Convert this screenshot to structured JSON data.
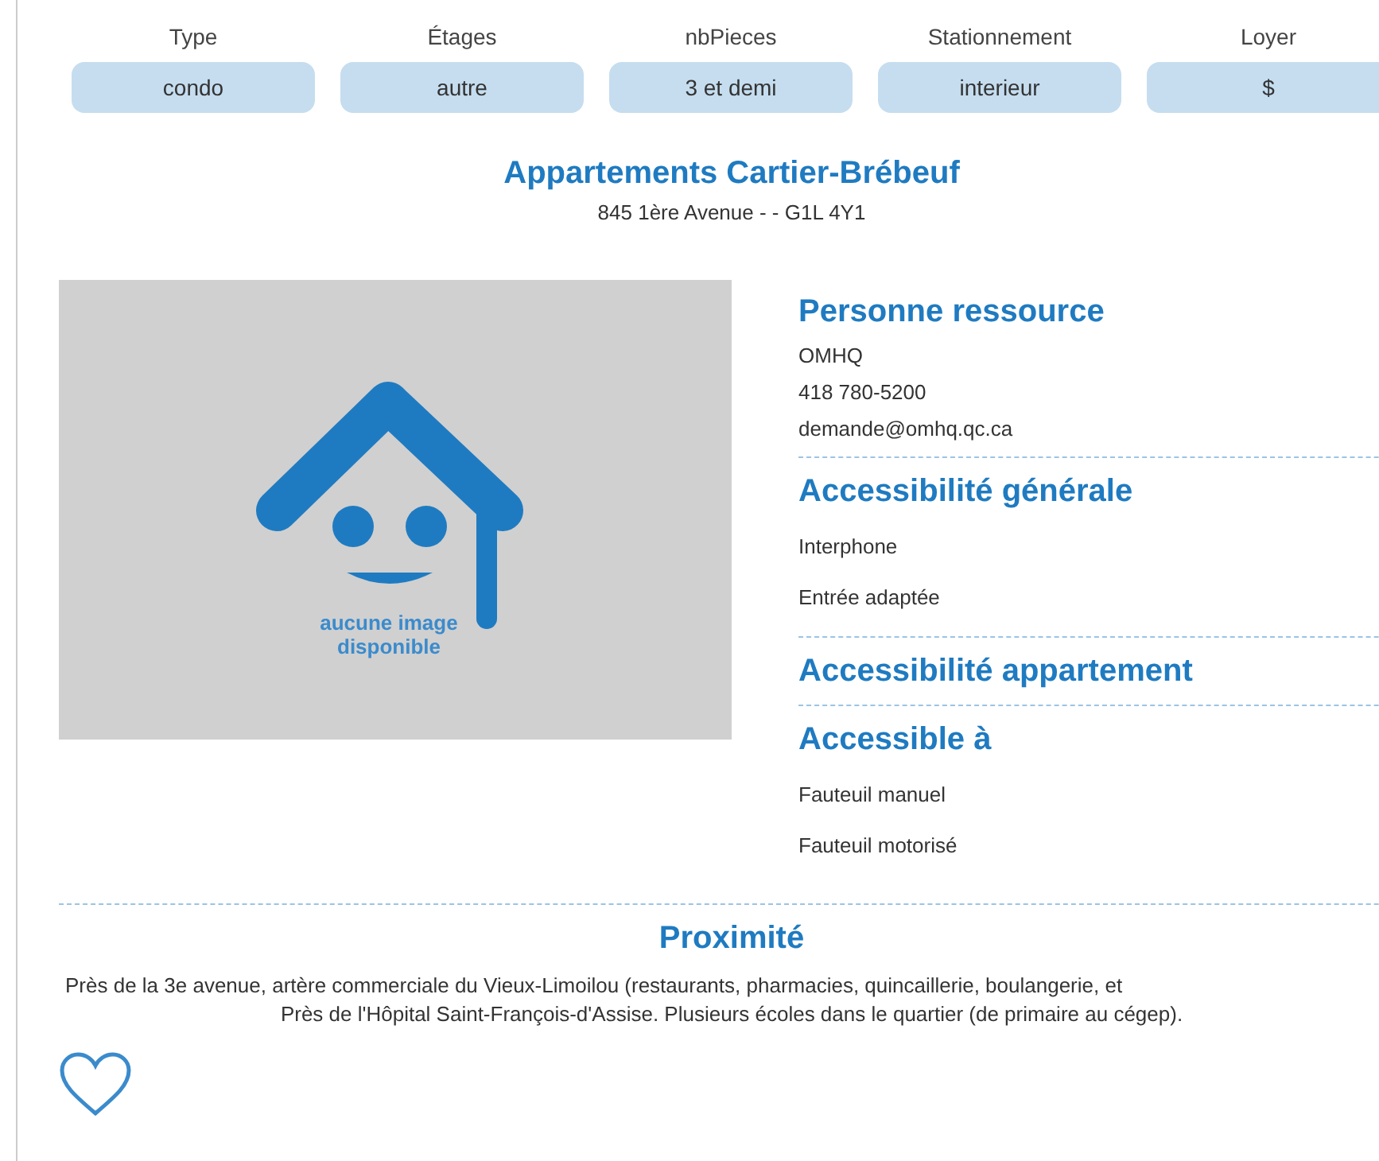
{
  "filters": [
    {
      "label": "Type",
      "value": "condo"
    },
    {
      "label": "Étages",
      "value": "autre"
    },
    {
      "label": "nbPieces",
      "value": "3 et demi"
    },
    {
      "label": "Stationnement",
      "value": "interieur"
    },
    {
      "label": "Loyer",
      "value": "$"
    }
  ],
  "listing": {
    "title": "Appartements Cartier-Brébeuf",
    "address": "845 1ère Avenue - - G1L 4Y1"
  },
  "photo": {
    "kind": "placeholder",
    "caption": [
      "aucune image",
      "disponible"
    ]
  },
  "contact": {
    "heading": "Personne ressource",
    "lines": [
      "OMHQ",
      "418 780-5200",
      "demande@omhq.qc.ca"
    ]
  },
  "sections": [
    {
      "heading": "Accessibilité générale",
      "items": [
        "Interphone",
        "Entrée adaptée"
      ]
    },
    {
      "heading": "Accessibilité appartement"
    },
    {
      "heading": "Accessible à",
      "items": [
        "Fauteuil manuel",
        "Fauteuil motorisé"
      ]
    }
  ],
  "proximity": {
    "heading": "Proximité",
    "lines": [
      "Près de la 3e avenue, artère commerciale du Vieux-Limoilou (restaurants, pharmacies, quincaillerie, boulangerie, et",
      "Près de l'Hôpital Saint-François-d'Assise. Plusieurs écoles dans le quartier (de primaire au cégep)."
    ]
  },
  "favorite": {
    "on": false
  }
}
